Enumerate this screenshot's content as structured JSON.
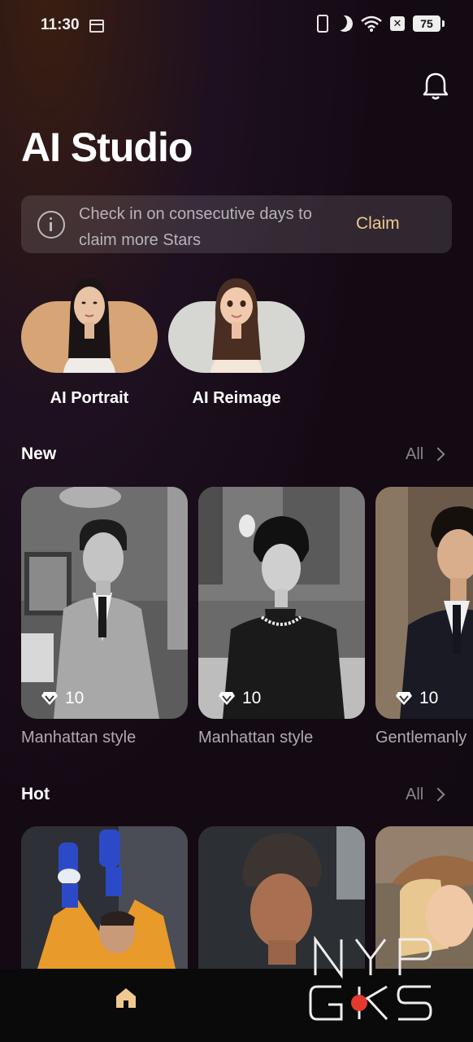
{
  "status_bar": {
    "time": "11:30",
    "battery": "75",
    "icons": [
      "calendar-icon",
      "vibrate-icon",
      "dnd-moon-icon",
      "wifi-icon",
      "no-sim-icon",
      "battery-icon"
    ]
  },
  "header": {
    "title": "AI Studio",
    "bell_icon": "bell-icon"
  },
  "banner": {
    "text": "Check in on consecutive days to claim more Stars",
    "action": "Claim",
    "icon": "info-icon"
  },
  "tools": [
    {
      "label": "AI Portrait",
      "color": "#d7a475"
    },
    {
      "label": "AI Reimage",
      "color": "#d6d7d3"
    }
  ],
  "sections": {
    "new": {
      "title": "New",
      "all_label": "All",
      "cards": [
        {
          "title": "Manhattan style",
          "stars": "10"
        },
        {
          "title": "Manhattan style",
          "stars": "10"
        },
        {
          "title": "Gentlemanly",
          "stars": "10"
        }
      ]
    },
    "hot": {
      "title": "Hot",
      "all_label": "All"
    }
  },
  "nav": {
    "active": "home-icon"
  },
  "colors": {
    "accent": "#f0c890",
    "background": "#120a12"
  }
}
